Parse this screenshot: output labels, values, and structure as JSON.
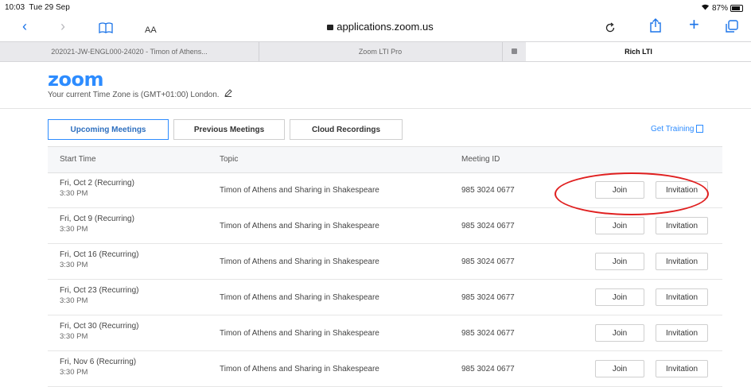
{
  "status_bar": {
    "time": "10:03",
    "date": "Tue 29 Sep",
    "battery": "87%"
  },
  "browser": {
    "address": "applications.zoom.us",
    "text_size_label": "AA",
    "tabs": [
      {
        "label": "202021-JW-ENGL000-24020 - Timon of Athens..."
      },
      {
        "label": "Zoom LTI Pro"
      },
      {
        "label": "Rich LTI"
      }
    ]
  },
  "zoom": {
    "logo": "zoom",
    "timezone_text": "Your current Time Zone is (GMT+01:00) London.",
    "tabs": [
      "Upcoming Meetings",
      "Previous Meetings",
      "Cloud Recordings"
    ],
    "get_training": "Get Training"
  },
  "table": {
    "headers": [
      "Start Time",
      "Topic",
      "Meeting ID"
    ],
    "rows": [
      {
        "date": "Fri, Oct 2 (Recurring)",
        "time": "3:30 PM",
        "topic": "Timon of Athens and Sharing in Shakespeare",
        "meeting_id": "985 3024 0677",
        "join": "Join",
        "invitation": "Invitation"
      },
      {
        "date": "Fri, Oct 9 (Recurring)",
        "time": "3:30 PM",
        "topic": "Timon of Athens and Sharing in Shakespeare",
        "meeting_id": "985 3024 0677",
        "join": "Join",
        "invitation": "Invitation"
      },
      {
        "date": "Fri, Oct 16 (Recurring)",
        "time": "3:30 PM",
        "topic": "Timon of Athens and Sharing in Shakespeare",
        "meeting_id": "985 3024 0677",
        "join": "Join",
        "invitation": "Invitation"
      },
      {
        "date": "Fri, Oct 23 (Recurring)",
        "time": "3:30 PM",
        "topic": "Timon of Athens and Sharing in Shakespeare",
        "meeting_id": "985 3024 0677",
        "join": "Join",
        "invitation": "Invitation"
      },
      {
        "date": "Fri, Oct 30 (Recurring)",
        "time": "3:30 PM",
        "topic": "Timon of Athens and Sharing in Shakespeare",
        "meeting_id": "985 3024 0677",
        "join": "Join",
        "invitation": "Invitation"
      },
      {
        "date": "Fri, Nov 6 (Recurring)",
        "time": "3:30 PM",
        "topic": "Timon of Athens and Sharing in Shakespeare",
        "meeting_id": "985 3024 0677",
        "join": "Join",
        "invitation": "Invitation"
      }
    ]
  },
  "colors": {
    "accent": "#2d8cff",
    "highlight_circle": "#e02020"
  }
}
